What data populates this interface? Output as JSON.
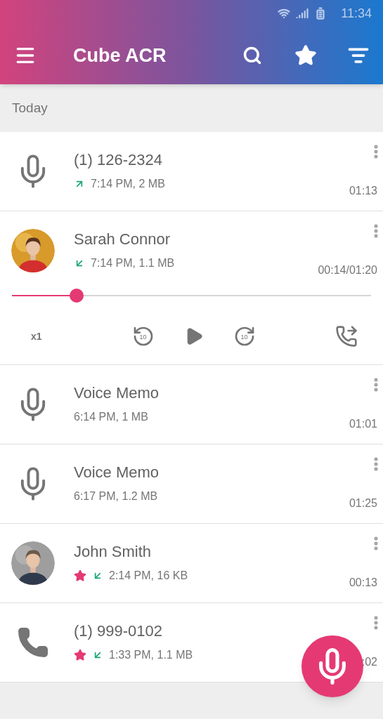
{
  "status_bar": {
    "time": "11:34"
  },
  "toolbar": {
    "title": "Cube ACR"
  },
  "section": {
    "label": "Today"
  },
  "recordings": [
    {
      "kind": "mic",
      "title": "(1) 126-2324",
      "outgoing": true,
      "incoming": false,
      "starred": false,
      "meta": "7:14 PM, 2 MB",
      "duration": "01:13",
      "expanded": false
    },
    {
      "title": "Sarah Connor",
      "outgoing": false,
      "incoming": true,
      "starred": false,
      "meta": "7:14 PM, 1.1 MB",
      "duration": "00:14/01:20",
      "expanded": true,
      "player": {
        "level": 0.18,
        "speed": "x1",
        "rewind": "10",
        "forward": "10"
      }
    },
    {
      "kind": "mic",
      "title": "Voice Memo",
      "outgoing": false,
      "incoming": false,
      "starred": false,
      "meta": "6:14 PM, 1 MB",
      "duration": "01:01",
      "expanded": false
    },
    {
      "kind": "mic",
      "title": "Voice Memo",
      "outgoing": false,
      "incoming": false,
      "starred": false,
      "meta": "6:17 PM, 1.2 MB",
      "duration": "01:25",
      "expanded": false
    },
    {
      "title": "John Smith",
      "outgoing": false,
      "incoming": true,
      "starred": true,
      "meta": "2:14 PM, 16 KB",
      "duration": "00:13",
      "expanded": false
    },
    {
      "kind": "phone",
      "title": "(1) 999-0102",
      "outgoing": false,
      "incoming": true,
      "starred": true,
      "meta": "1:33 PM, 1.1 MB",
      "duration": ":02",
      "expanded": false
    }
  ]
}
